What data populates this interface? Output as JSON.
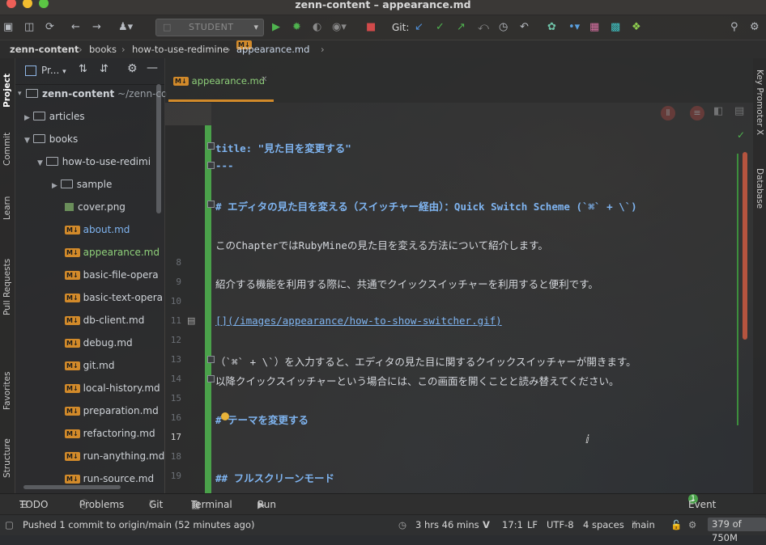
{
  "window": {
    "title": "zenn-content – appearance.md"
  },
  "toolbar": {
    "run_config": "STUDENT",
    "git_label": "Git:"
  },
  "breadcrumb": [
    "zenn-content",
    "books",
    "how-to-use-redimine",
    "appearance.md"
  ],
  "left_tool_tabs": [
    "Project",
    "Commit",
    "Learn",
    "Pull Requests",
    "Favorites",
    "Structure"
  ],
  "right_tool_tabs": [
    "Key Promoter X",
    "Database"
  ],
  "project_panel": {
    "title": "Pr...",
    "root": "zenn-content",
    "root_path": "~/zenn-co",
    "items": [
      {
        "label": "articles",
        "type": "folder"
      },
      {
        "label": "books",
        "type": "folder"
      },
      {
        "label": "how-to-use-redimi",
        "type": "folder"
      },
      {
        "label": "sample",
        "type": "folder"
      },
      {
        "label": "cover.png",
        "type": "image"
      },
      {
        "label": "about.md",
        "type": "md"
      },
      {
        "label": "appearance.md",
        "type": "md"
      },
      {
        "label": "basic-file-opera",
        "type": "md"
      },
      {
        "label": "basic-text-opera",
        "type": "md"
      },
      {
        "label": "db-client.md",
        "type": "md"
      },
      {
        "label": "debug.md",
        "type": "md"
      },
      {
        "label": "git.md",
        "type": "md"
      },
      {
        "label": "local-history.md",
        "type": "md"
      },
      {
        "label": "preparation.md",
        "type": "md"
      },
      {
        "label": "refactoring.md",
        "type": "md"
      },
      {
        "label": "run-anything.md",
        "type": "md"
      },
      {
        "label": "run-source.md",
        "type": "md"
      }
    ]
  },
  "editor": {
    "tab": "appearance.md",
    "lines": [
      {
        "n": "",
        "text": "title: \"見た目を変更する\"",
        "style": "heading"
      },
      {
        "n": "",
        "text": "---",
        "style": "heading"
      },
      {
        "n": "",
        "text": "",
        "style": "plain"
      },
      {
        "n": "",
        "text": "# エディタの見た目を変える（スイッチャー経由）：Quick Switch Scheme (`⌘` + \\`)",
        "style": "heading"
      },
      {
        "n": "",
        "text": "",
        "style": "plain"
      },
      {
        "n": "",
        "text": "このChapterではRubyMineの見た目を変える方法について紹介します。",
        "style": "plain"
      },
      {
        "n": "8",
        "text": "",
        "style": "plain"
      },
      {
        "n": "9",
        "text": "紹介する機能を利用する際に、共通でクイックスイッチャーを利用すると便利です。",
        "style": "plain"
      },
      {
        "n": "10",
        "text": "",
        "style": "plain"
      },
      {
        "n": "11",
        "text": " [](/images/appearance/how-to-show-switcher.gif)",
        "style": "link"
      },
      {
        "n": "12",
        "text": "",
        "style": "plain"
      },
      {
        "n": "13",
        "text": "（`⌘` + \\`）を入力すると、エディタの見た目に関するクイックスイッチャーが開きます。",
        "style": "plain"
      },
      {
        "n": "14",
        "text": "以降クイックスイッチャーという場合には、この画面を開くことと読み替えてください。",
        "style": "plain"
      },
      {
        "n": "15",
        "text": "",
        "style": "plain"
      },
      {
        "n": "16",
        "text": "# テーマを変更する",
        "style": "heading"
      },
      {
        "n": "17",
        "text": "",
        "style": "plain"
      },
      {
        "n": "18",
        "text": "",
        "style": "plain"
      },
      {
        "n": "19",
        "text": "## フルスクリーンモード",
        "style": "heading"
      }
    ]
  },
  "bottom_tabs": [
    "TODO",
    "Problems",
    "Git",
    "Terminal",
    "Run",
    "Event Log"
  ],
  "status": {
    "message": "Pushed 1 commit to origin/main (52 minutes ago)",
    "time": "3 hrs 46 mins",
    "position": "17:1",
    "line_sep": "LF",
    "encoding": "UTF-8",
    "indent": "4 spaces",
    "branch": "main",
    "memory": "379 of 750M"
  },
  "colors": {
    "accent": "#4aa14a",
    "heading": "#7fb4f0",
    "md_badge": "#d28a2a"
  }
}
